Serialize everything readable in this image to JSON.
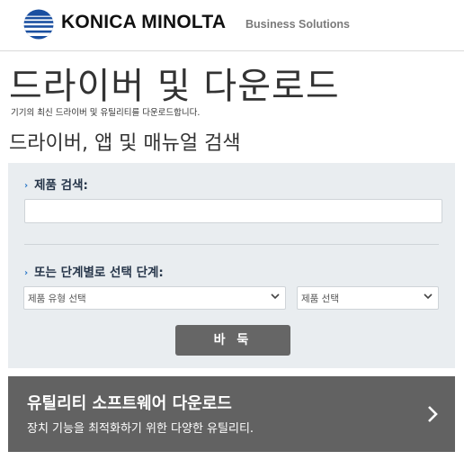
{
  "header": {
    "brand": "KONICA MINOLTA",
    "tagline": "Business Solutions",
    "logo_icon": "konica-minolta-globe-logo"
  },
  "page": {
    "title": "드라이버 및 다운로드",
    "subtitle": "기기의 최신 드라이버 및 유틸리티를 다운로드합니다.",
    "section_title": "드라이버, 앱 및 매뉴얼 검색"
  },
  "search": {
    "product_label": "제품 검색:",
    "product_value": "",
    "product_placeholder": "",
    "step_label": "또는 단계별로 선택 단계:",
    "type_select": "제품 유형 선택",
    "product_select": "제품 선택",
    "go_button": "바 둑"
  },
  "utility": {
    "title": "유틸리티 소프트웨어 다운로드",
    "description": "장치 기능을 최적화하기 위한 다양한 유틸리티."
  },
  "colors": {
    "brand_blue": "#1a4fa0",
    "button_gray": "#666666",
    "panel_bg": "#e9edf0",
    "utility_bg": "#626262",
    "arrow_blue": "#2c78c8"
  }
}
